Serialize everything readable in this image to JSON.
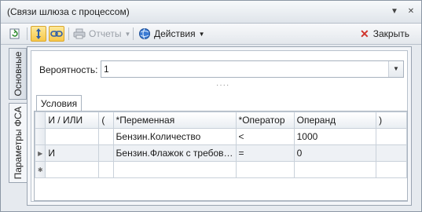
{
  "window": {
    "title": "(Связи шлюза с процессом)"
  },
  "toolbar": {
    "reports_label": "Отчеты",
    "actions_label": "Действия",
    "close_label": "Закрыть"
  },
  "tabs": {
    "main_label": "Основные",
    "params_label": "Параметры ФСА"
  },
  "probability": {
    "label": "Вероятность:",
    "value": "1"
  },
  "conditions": {
    "tab_label": "Условия",
    "columns": [
      "И / ИЛИ",
      "(",
      "*Переменная",
      "*Оператор",
      "Операнд",
      ")"
    ],
    "rows": [
      {
        "and_or": "",
        "open": "",
        "variable": "Бензин.Количество",
        "operator": "<",
        "operand": "1000",
        "close": ""
      },
      {
        "and_or": "И",
        "open": "",
        "variable": "Бензин.Флажок с требов…",
        "operator": "=",
        "operand": "0",
        "close": ""
      }
    ]
  }
}
